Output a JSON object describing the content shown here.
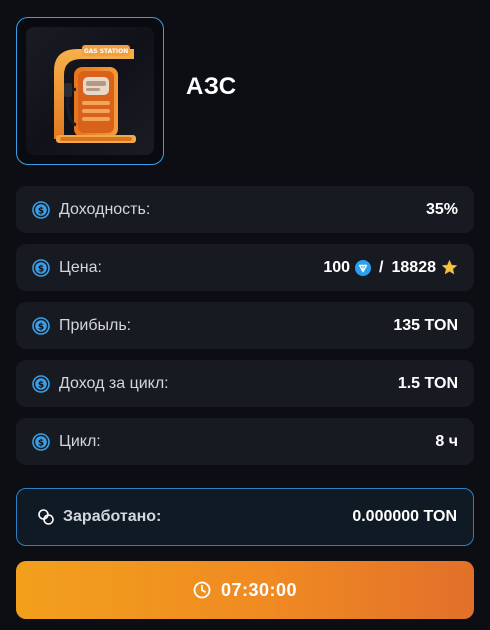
{
  "item": {
    "title": "АЗС",
    "image": "gas-station-illustration",
    "sign_text": "GAS STATION"
  },
  "stats": [
    {
      "key": "yield",
      "label": "Доходность:",
      "value": "35%"
    },
    {
      "key": "price",
      "label": "Цена:",
      "ton_value": "100",
      "separator": "/",
      "stars_value": "18828"
    },
    {
      "key": "profit",
      "label": "Прибыль:",
      "value": "135 TON"
    },
    {
      "key": "cycle_income",
      "label": "Доход за цикл:",
      "value": "1.5 TON"
    },
    {
      "key": "cycle",
      "label": "Цикл:",
      "value": "8 ч"
    }
  ],
  "earned": {
    "label": "Заработано:",
    "value": "0.000000 TON"
  },
  "timer_button": {
    "time": "07:30:00",
    "icon": "clock-icon"
  },
  "colors": {
    "accent_blue": "#3a9fe8",
    "button_orange": "#f08a22",
    "star_yellow": "#f5c542",
    "ton_blue": "#2aa1f0"
  }
}
